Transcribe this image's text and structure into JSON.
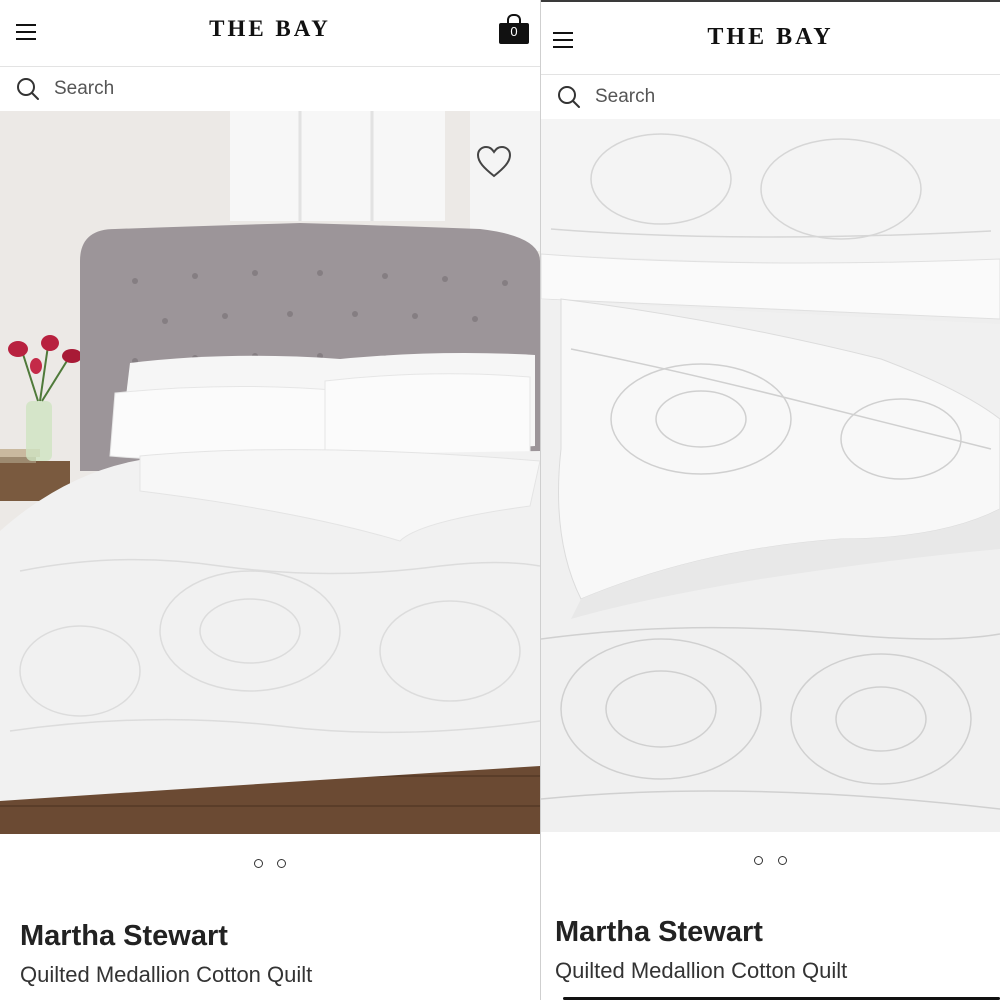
{
  "left": {
    "logo": "THE BAY",
    "cart_count": "0",
    "search": {
      "placeholder": "Search"
    },
    "icons": [
      "menu-icon",
      "shopping-bag-icon",
      "search-icon",
      "heart-icon"
    ],
    "carousel": {
      "total": 2,
      "active": 1
    },
    "product": {
      "brand": "Martha Stewart",
      "name": "Quilted Medallion Cotton Quilt"
    }
  },
  "right": {
    "logo": "THE BAY",
    "search": {
      "placeholder": "Search"
    },
    "icons": [
      "menu-icon",
      "search-icon"
    ],
    "carousel": {
      "total": 2,
      "active": 2
    },
    "product": {
      "brand": "Martha Stewart",
      "name": "Quilted Medallion Cotton Quilt"
    }
  },
  "colors": {
    "headboard": "#9c9599",
    "quilt": "#f1f1f1",
    "floor": "#6b4a33",
    "wall": "#ece9e6",
    "flowers": "#b8213f"
  }
}
